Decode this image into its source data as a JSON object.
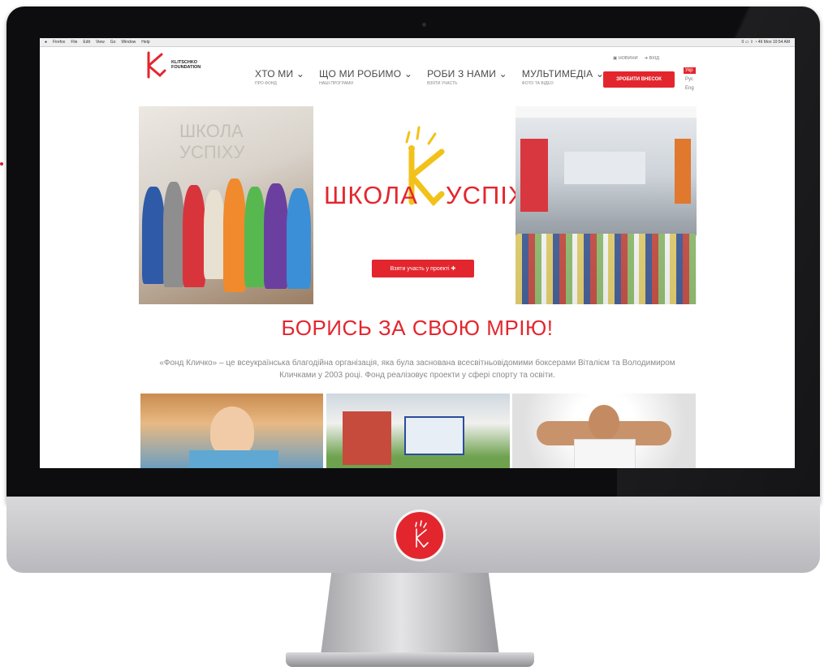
{
  "menubar": {
    "items": [
      "Firefox",
      "File",
      "Edit",
      "View",
      "Go",
      "Window",
      "Help"
    ],
    "right": "0 ▭ ⇪ ◔ 46 Mon 10:54 AM"
  },
  "logo": {
    "line1": "KLITSCHKO",
    "line2": "FOUNDATION"
  },
  "nav": [
    {
      "title": "ХТО МИ",
      "sub": "про фонд"
    },
    {
      "title": "ЩО МИ РОБИМО",
      "sub": "наші програми"
    },
    {
      "title": "РОБИ З НАМИ",
      "sub": "взяти участь"
    },
    {
      "title": "МУЛЬТИМЕДІА",
      "sub": "фото та відео"
    }
  ],
  "top_links": {
    "news": "НОВИНИ",
    "login": "ВХІД"
  },
  "donate_label": "ЗРОБИТИ ВНЕСОК",
  "languages": [
    "Укр",
    "Рус",
    "Eng"
  ],
  "banner": {
    "wordmark_left": "ШКОЛА",
    "wordmark_right": "УСПІХУ",
    "cta_label": "Взяти участь у проекті",
    "left_photo_sign": "ШКОЛА УСПІХУ"
  },
  "headline": "БОРИСЬ ЗА СВОЮ МРІЮ!",
  "intro": "«Фонд Кличко» – це всеукраїнська благодійна організація, яка була заснована всесвітньовідомими боксерами Віталієм та Володимиром Кличками у 2003 році. Фонд реалізовує проекти у сфері спорту та освіти.",
  "colors": {
    "brand_red": "#e3262e",
    "frame": "#0d0d0f",
    "chin": "#c9c9cc"
  },
  "icons": {
    "chevron": "chevron-down-icon",
    "logo_mark": "klitschko-k-logo"
  }
}
